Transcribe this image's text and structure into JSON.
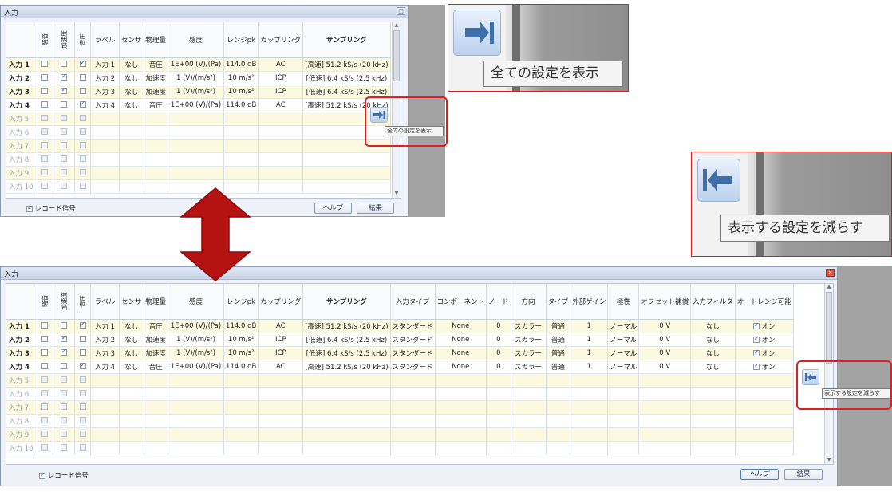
{
  "window": {
    "title": "入力",
    "help_label": "ヘルプ",
    "close_label": "結果",
    "record_label": "レコード信号"
  },
  "columns_compact": [
    "騒音",
    "加速度",
    "音圧",
    "ラベル",
    "センサ",
    "物理量",
    "感度",
    "レンジpk",
    "カップリング",
    "サンプリング"
  ],
  "columns_extra": [
    "入力タイプ",
    "コンポーネント",
    "ノード",
    "方向",
    "タイプ",
    "外部ゲイン",
    "極性",
    "オフセット補償",
    "入力フィルタ",
    "オートレンジ可能"
  ],
  "rows": [
    {
      "name": "入力 1",
      "enabled": true,
      "noise": false,
      "accel": false,
      "sound": true,
      "label": "入力 1",
      "sensor": "なし",
      "quantity": "音圧",
      "sensitivity": "1E+00 (V)/(Pa)",
      "range": "114.0 dB",
      "coupling": "AC",
      "sampling": "[高速] 51.2 kS/s (20 kHz)",
      "input_type": "スタンダード",
      "component": "None",
      "node": "0",
      "direction": "スカラー",
      "type": "普通",
      "gain": "1",
      "polarity": "ノーマル",
      "offset": "0 V",
      "filter": "なし",
      "autorange": true,
      "autorange_val": "オン"
    },
    {
      "name": "入力 2",
      "enabled": true,
      "noise": false,
      "accel": true,
      "sound": false,
      "label": "入力 2",
      "sensor": "なし",
      "quantity": "加速度",
      "sensitivity": "1 (V)/(m/s²)",
      "range": "10 m/s²",
      "coupling": "ICP",
      "sampling": "[低速] 6.4 kS/s (2.5 kHz)",
      "input_type": "スタンダード",
      "component": "None",
      "node": "0",
      "direction": "スカラー",
      "type": "普通",
      "gain": "1",
      "polarity": "ノーマル",
      "offset": "0 V",
      "filter": "なし",
      "autorange": true,
      "autorange_val": "オン"
    },
    {
      "name": "入力 3",
      "enabled": true,
      "noise": false,
      "accel": true,
      "sound": false,
      "label": "入力 3",
      "sensor": "なし",
      "quantity": "加速度",
      "sensitivity": "1 (V)/(m/s²)",
      "range": "10 m/s²",
      "coupling": "ICP",
      "sampling": "[低速] 6.4 kS/s (2.5 kHz)",
      "input_type": "スタンダード",
      "component": "None",
      "node": "0",
      "direction": "スカラー",
      "type": "普通",
      "gain": "1",
      "polarity": "ノーマル",
      "offset": "0 V",
      "filter": "なし",
      "autorange": true,
      "autorange_val": "オン"
    },
    {
      "name": "入力 4",
      "enabled": true,
      "noise": false,
      "accel": false,
      "sound": true,
      "label": "入力 4",
      "sensor": "なし",
      "quantity": "音圧",
      "sensitivity": "1E+00 (V)/(Pa)",
      "range": "114.0 dB",
      "coupling": "AC",
      "sampling": "[高速] 51.2 kS/s (20 kHz)",
      "input_type": "スタンダード",
      "component": "None",
      "node": "0",
      "direction": "スカラー",
      "type": "普通",
      "gain": "1",
      "polarity": "ノーマル",
      "offset": "0 V",
      "filter": "なし",
      "autorange": true,
      "autorange_val": "オン"
    },
    {
      "name": "入力 5",
      "enabled": false
    },
    {
      "name": "入力 6",
      "enabled": false
    },
    {
      "name": "入力 7",
      "enabled": false
    },
    {
      "name": "入力 8",
      "enabled": false
    },
    {
      "name": "入力 9",
      "enabled": false
    },
    {
      "name": "入力 10",
      "enabled": false
    }
  ],
  "tooltips": {
    "show_all": "全ての設定を表示",
    "show_less": "表示する設定を減らす"
  },
  "colors": {
    "highlight": "#e02020",
    "arrow": "#b51212",
    "row_alt": "#fbf9df"
  },
  "icons": {
    "expand": "arrow-right-bar-icon",
    "collapse": "arrow-left-bar-icon",
    "swap": "double-arrow-icon"
  }
}
